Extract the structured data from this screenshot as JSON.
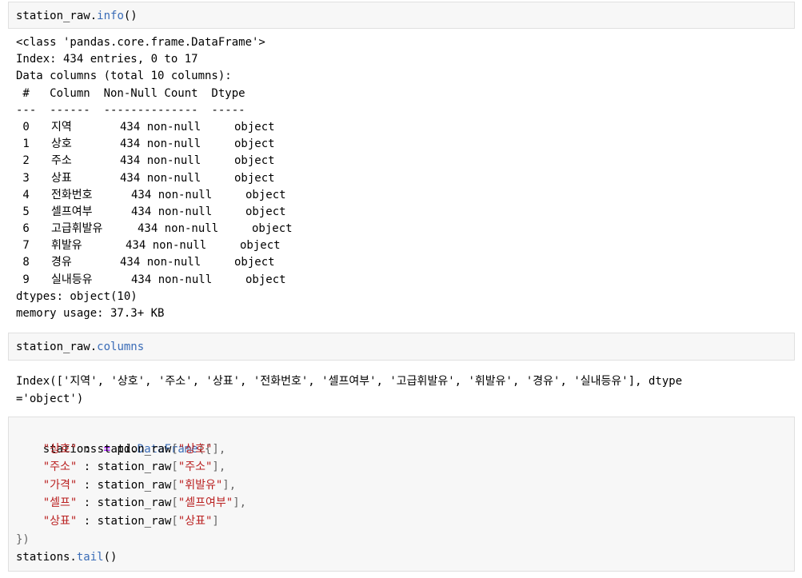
{
  "cells": {
    "c1": {
      "obj": "station_raw",
      "attr": "info",
      "tail": "()"
    },
    "info": {
      "l1": "<class 'pandas.core.frame.DataFrame'>",
      "l2": "Index: 434 entries, 0 to 17",
      "l3": "Data columns (total 10 columns):",
      "l4": " #   Column  Non-Null Count  Dtype ",
      "l5": "---  ------  --------------  ----- ",
      "rows": [
        {
          "idx": " 0",
          "col": "지역",
          "cnt": "434 non-null",
          "dtype": "object"
        },
        {
          "idx": " 1",
          "col": "상호",
          "cnt": "434 non-null",
          "dtype": "object"
        },
        {
          "idx": " 2",
          "col": "주소",
          "cnt": "434 non-null",
          "dtype": "object"
        },
        {
          "idx": " 3",
          "col": "상표",
          "cnt": "434 non-null",
          "dtype": "object"
        },
        {
          "idx": " 4",
          "col": "전화번호",
          "cnt": "434 non-null",
          "dtype": "object"
        },
        {
          "idx": " 5",
          "col": "셀프여부",
          "cnt": "434 non-null",
          "dtype": "object"
        },
        {
          "idx": " 6",
          "col": "고급휘발유",
          "cnt": "434 non-null",
          "dtype": "object"
        },
        {
          "idx": " 7",
          "col": "휘발유",
          "cnt": "434 non-null",
          "dtype": "object"
        },
        {
          "idx": " 8",
          "col": "경유",
          "cnt": "434 non-null",
          "dtype": "object"
        },
        {
          "idx": " 9",
          "col": "실내등유",
          "cnt": "434 non-null",
          "dtype": "object"
        }
      ],
      "l6": "dtypes: object(10)",
      "l7": "memory usage: 37.3+ KB"
    },
    "c2": {
      "obj": "station_raw",
      "attr": "columns"
    },
    "columns_out": {
      "l1": "Index(['지역', '상호', '주소', '상표', '전화번호', '셀프여부', '고급휘발유', '휘발유', '경유', '실내등유'], dtype",
      "l2": "='object')"
    },
    "c3": {
      "var": "stations",
      "eq": "=",
      "call_obj": "pd.",
      "call_attr": "DataFrame",
      "open": "({",
      "src": "station_raw",
      "items": [
        {
          "key": "\"상호\"",
          "col": "\"상호\"",
          "end": "],"
        },
        {
          "key": "\"주소\"",
          "col": "\"주소\"",
          "end": "],"
        },
        {
          "key": "\"가격\"",
          "col": "\"휘발유\"",
          "end": "],"
        },
        {
          "key": "\"셀프\"",
          "col": "\"셀프여부\"",
          "end": "],"
        },
        {
          "key": "\"상표\"",
          "col": "\"상표\"",
          "end": "]"
        }
      ],
      "close": "})",
      "last_obj": "stations.",
      "last_attr": "tail",
      "last_tail": "()"
    }
  }
}
